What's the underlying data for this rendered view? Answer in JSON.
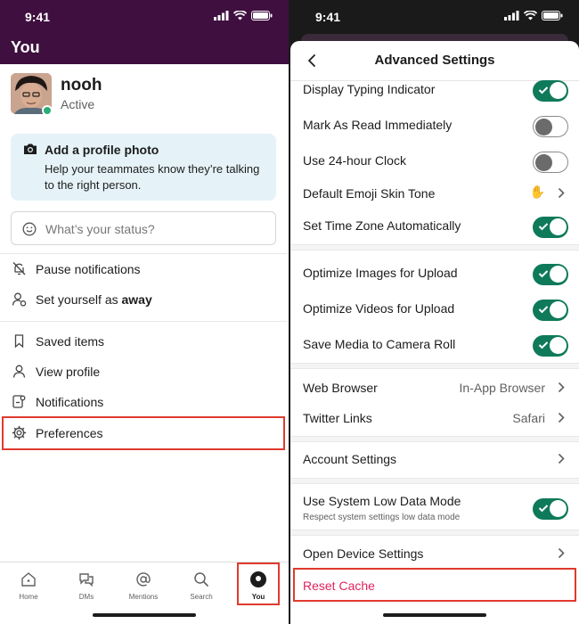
{
  "status_bar": {
    "time": "9:41"
  },
  "left": {
    "header_title": "You",
    "profile": {
      "name": "nooh",
      "status": "Active"
    },
    "photo_card": {
      "title": "Add a profile photo",
      "body": "Help your teammates know they’re talking to the right person."
    },
    "status_input": {
      "placeholder": "What’s your status?"
    },
    "menu": {
      "pause": "Pause notifications",
      "away_prefix": "Set yourself as ",
      "away_bold": "away",
      "saved": "Saved items",
      "profile": "View profile",
      "notifications": "Notifications",
      "preferences": "Preferences"
    },
    "tabs": {
      "home": "Home",
      "dms": "DMs",
      "mentions": "Mentions",
      "search": "Search",
      "you": "You"
    }
  },
  "right": {
    "title": "Advanced Settings",
    "rows": {
      "typing": "Display Typing Indicator",
      "mark_read": "Mark As Read Immediately",
      "clock24": "Use 24-hour Clock",
      "emoji_tone": "Default Emoji Skin Tone",
      "emoji_tone_value": "✋",
      "timezone": "Set Time Zone Automatically",
      "opt_images": "Optimize Images for Upload",
      "opt_videos": "Optimize Videos for Upload",
      "save_media": "Save Media to Camera Roll",
      "browser": "Web Browser",
      "browser_value": "In-App Browser",
      "twitter": "Twitter Links",
      "twitter_value": "Safari",
      "account": "Account Settings",
      "low_data": "Use System Low Data Mode",
      "low_data_sub": "Respect system settings low data mode",
      "device": "Open Device Settings",
      "reset": "Reset Cache"
    }
  },
  "colors": {
    "aubergine": "#3f0f3f",
    "toggle_on": "#0e7a5a",
    "danger": "#e0245e",
    "highlight": "#e03a2e"
  }
}
